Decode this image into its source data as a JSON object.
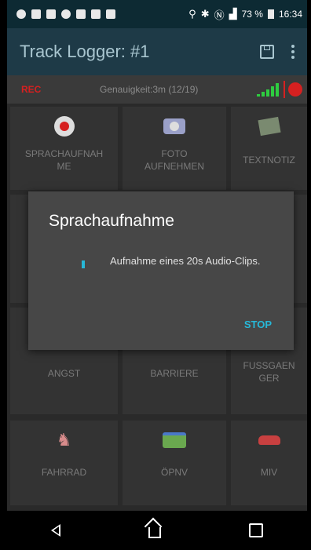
{
  "statusbar": {
    "battery": "73 %",
    "time": "16:34"
  },
  "appbar": {
    "title": "Track Logger: #1",
    "icons": [
      "save-icon",
      "more-vert-icon"
    ]
  },
  "infobar": {
    "rec_label": "REC",
    "accuracy": "Genauigkeit:3m (12/19)"
  },
  "tiles": [
    {
      "label": "SPRACHAUFNAH\nME",
      "icon": "record-icon"
    },
    {
      "label": "FOTO\nAUFNEHMEN",
      "icon": "camera-icon"
    },
    {
      "label": "TEXTNOTIZ",
      "icon": "note-icon"
    },
    {
      "label": "ANGST",
      "icon": ""
    },
    {
      "label": "BARRIERE",
      "icon": ""
    },
    {
      "label": "FUSSGAEN\nGER",
      "icon": ""
    },
    {
      "label": "FAHRRAD",
      "icon": "bicycle-icon"
    },
    {
      "label": "ÖPNV",
      "icon": "bus-icon"
    },
    {
      "label": "MIV",
      "icon": "car-icon"
    }
  ],
  "dialog": {
    "title": "Sprachaufnahme",
    "message": "Aufnahme eines 20s Audio-Clips.",
    "stop_label": "STOP"
  },
  "colors": {
    "accent": "#27b8d8",
    "record": "#d62020",
    "appbar": "#1e3a47"
  }
}
